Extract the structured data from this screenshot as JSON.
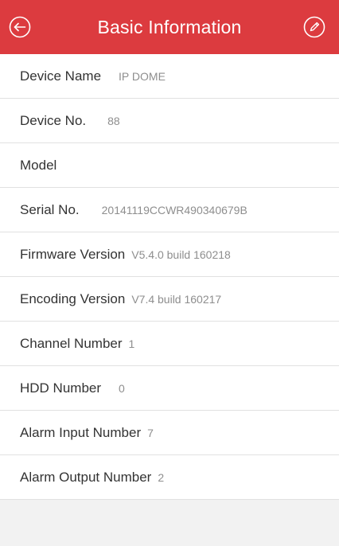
{
  "header": {
    "title": "Basic Information",
    "back_icon": "back-arrow-icon",
    "edit_icon": "pencil-edit-icon",
    "bg_color": "#dc3b3f"
  },
  "rows": [
    {
      "label": "Device Name",
      "value": "IP DOME"
    },
    {
      "label": "Device No.",
      "value": "88"
    },
    {
      "label": "Model",
      "value": ""
    },
    {
      "label": "Serial No.",
      "value": "20141119CCWR490340679B"
    },
    {
      "label": "Firmware Version",
      "value": "V5.4.0 build 160218"
    },
    {
      "label": "Encoding Version",
      "value": "V7.4 build 160217"
    },
    {
      "label": "Channel Number",
      "value": "1"
    },
    {
      "label": "HDD Number",
      "value": "0"
    },
    {
      "label": "Alarm Input Number",
      "value": "7"
    },
    {
      "label": "Alarm Output Number",
      "value": "2"
    }
  ]
}
